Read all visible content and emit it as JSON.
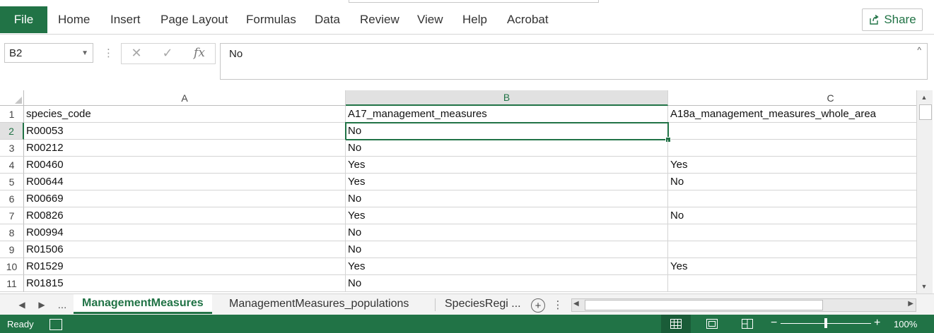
{
  "ribbon": {
    "file_label": "File",
    "tabs": [
      "Home",
      "Insert",
      "Page Layout",
      "Formulas",
      "Data",
      "Review",
      "View",
      "Help",
      "Acrobat"
    ],
    "share_label": "Share",
    "accent_color": "#217346"
  },
  "formula_bar": {
    "name_box": "B2",
    "fx_label": "fx",
    "value": "No"
  },
  "grid": {
    "columns": [
      "A",
      "B",
      "C"
    ],
    "selected_column": "B",
    "selected_row": "2",
    "rows": [
      {
        "num": "1",
        "a": "species_code",
        "b": "A17_management_measures",
        "c": "A18a_management_measures_whole_area"
      },
      {
        "num": "2",
        "a": "R00053",
        "b": "No",
        "c": ""
      },
      {
        "num": "3",
        "a": "R00212",
        "b": "No",
        "c": ""
      },
      {
        "num": "4",
        "a": "R00460",
        "b": "Yes",
        "c": "Yes"
      },
      {
        "num": "5",
        "a": "R00644",
        "b": "Yes",
        "c": "No"
      },
      {
        "num": "6",
        "a": "R00669",
        "b": "No",
        "c": ""
      },
      {
        "num": "7",
        "a": "R00826",
        "b": "Yes",
        "c": "No"
      },
      {
        "num": "8",
        "a": "R00994",
        "b": "No",
        "c": ""
      },
      {
        "num": "9",
        "a": "R01506",
        "b": "No",
        "c": ""
      },
      {
        "num": "10",
        "a": "R01529",
        "b": "Yes",
        "c": "Yes"
      },
      {
        "num": "11",
        "a": "R01815",
        "b": "No",
        "c": ""
      }
    ]
  },
  "sheet_tabs": {
    "ellipsis": "...",
    "tabs": [
      "ManagementMeasures",
      "ManagementMeasures_populations",
      "SpeciesRegi ..."
    ],
    "active": "ManagementMeasures"
  },
  "status_bar": {
    "ready": "Ready",
    "zoom": "100%"
  }
}
